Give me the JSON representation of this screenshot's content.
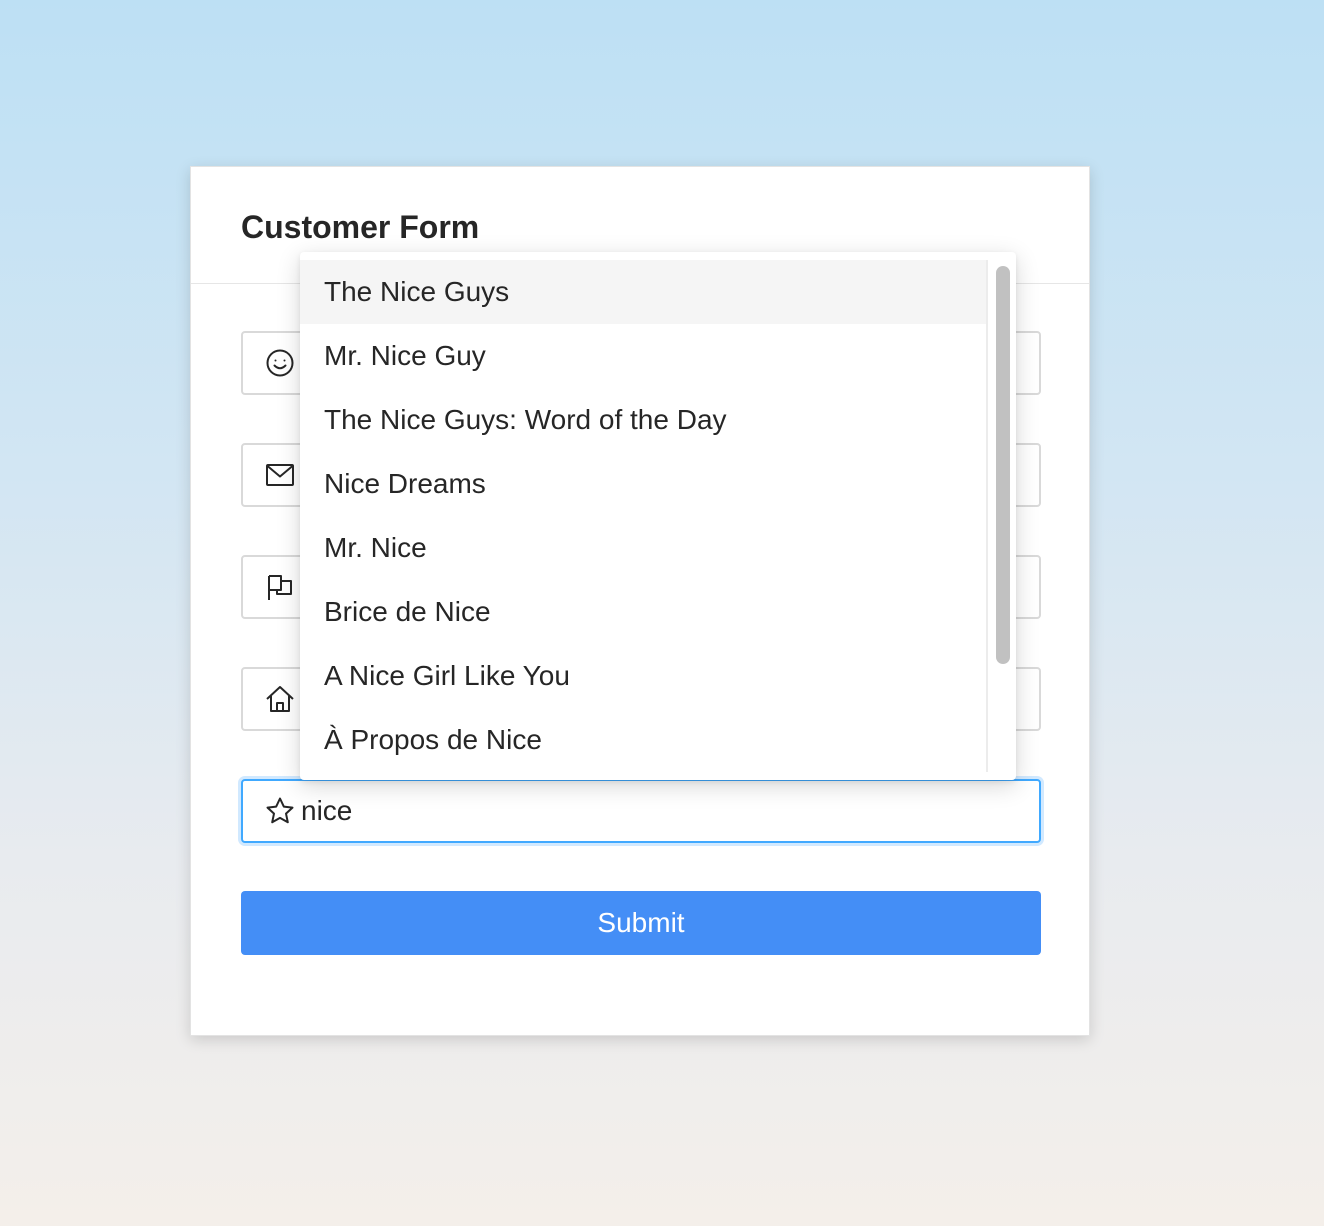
{
  "form": {
    "title": "Customer Form",
    "fields": [
      {
        "icon": "smile-icon",
        "value": "",
        "placeholder": ""
      },
      {
        "icon": "mail-icon",
        "value": "",
        "placeholder": ""
      },
      {
        "icon": "flag-icon",
        "value": "",
        "placeholder": ""
      },
      {
        "icon": "home-icon",
        "value": "",
        "placeholder": ""
      },
      {
        "icon": "star-icon",
        "value": "nice",
        "placeholder": ""
      }
    ],
    "submit_label": "Submit"
  },
  "autocomplete": {
    "options": [
      "The Nice Guys",
      "Mr. Nice Guy",
      "The Nice Guys: Word of the Day",
      "Nice Dreams",
      "Mr. Nice",
      "Brice de Nice",
      "A Nice Girl Like You",
      "À Propos de Nice"
    ],
    "active_index": 0
  },
  "colors": {
    "accent": "#448ef6",
    "focus_border": "#40a9ff",
    "active_option_bg": "#f5f5f5"
  }
}
